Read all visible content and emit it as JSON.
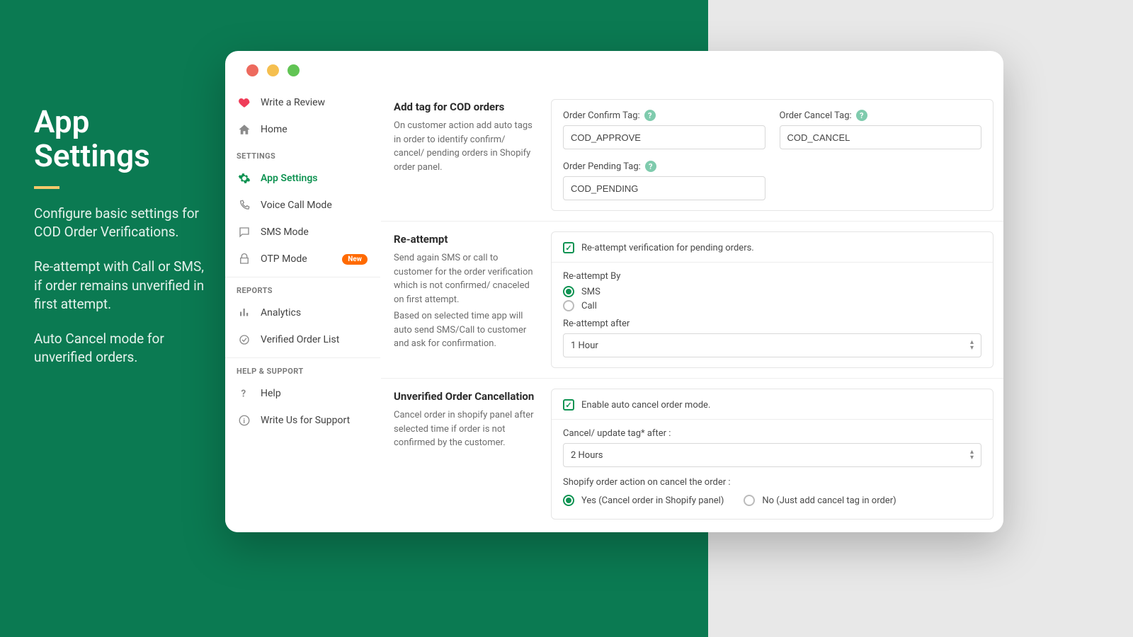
{
  "promo": {
    "title": "App Settings",
    "p1": "Configure basic settings for COD Order Verifications.",
    "p2": "Re-attempt with Call or SMS, if order remains unverified in first attempt.",
    "p3": "Auto Cancel mode for unverified orders."
  },
  "sidebar": {
    "write_review": "Write a Review",
    "home": "Home",
    "group_settings": "SETTINGS",
    "app_settings": "App Settings",
    "voice_call": "Voice Call Mode",
    "sms_mode": "SMS Mode",
    "otp_mode": "OTP Mode",
    "badge_new": "New",
    "group_reports": "REPORTS",
    "analytics": "Analytics",
    "verified_list": "Verified Order List",
    "group_help": "HELP & SUPPORT",
    "help": "Help",
    "write_us": "Write Us for Support"
  },
  "sections": {
    "tags": {
      "title": "Add tag for COD orders",
      "desc": "On customer action add auto tags in order to identify confirm/ cancel/ pending orders in Shopify order panel.",
      "confirm_label": "Order Confirm Tag:",
      "confirm_value": "COD_APPROVE",
      "cancel_label": "Order Cancel Tag:",
      "cancel_value": "COD_CANCEL",
      "pending_label": "Order Pending Tag:",
      "pending_value": "COD_PENDING"
    },
    "reattempt": {
      "title": "Re-attempt",
      "desc1": "Send again SMS or call to customer for the order verification which is not confirmed/ cnaceled on first attempt.",
      "desc2": "Based on selected time app will auto send SMS/Call to customer and ask for confirmation.",
      "checkbox": "Re-attempt verification for pending orders.",
      "by_label": "Re-attempt By",
      "by_sms": "SMS",
      "by_call": "Call",
      "after_label": "Re-attempt after",
      "after_value": "1 Hour"
    },
    "cancel": {
      "title": "Unverified Order Cancellation",
      "desc": "Cancel order in shopify panel after selected time if order is not confirmed by the customer.",
      "checkbox": "Enable auto cancel order mode.",
      "after_label": "Cancel/ update tag* after :",
      "after_value": "2 Hours",
      "action_label": "Shopify order action on cancel the order :",
      "action_yes": "Yes (Cancel order in Shopify panel)",
      "action_no": "No (Just add cancel tag in order)"
    }
  }
}
